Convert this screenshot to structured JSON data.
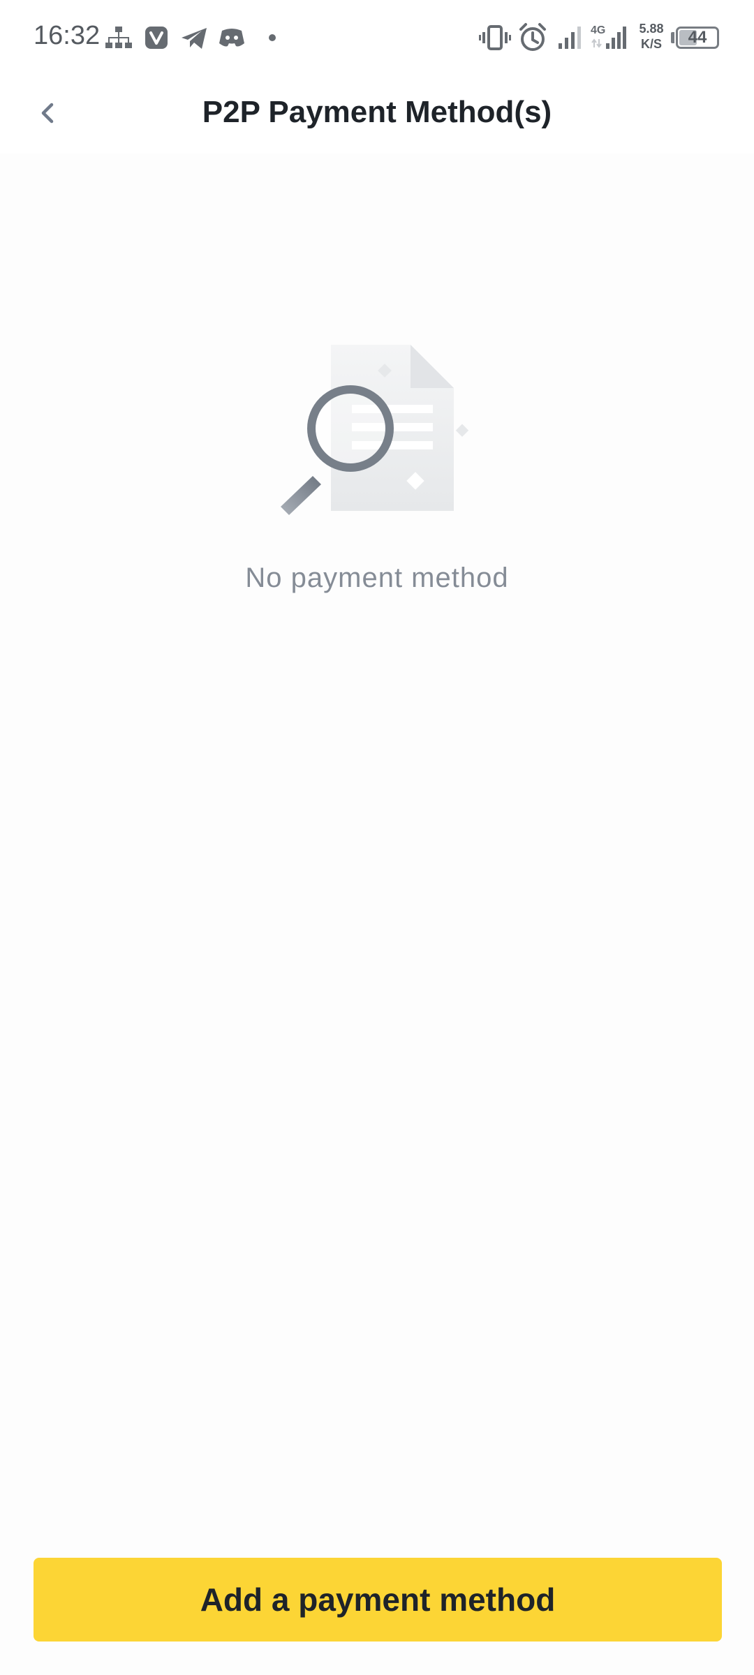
{
  "status_bar": {
    "time": "16:32",
    "network_type": "4G",
    "net_speed_value": "5.88",
    "net_speed_unit": "K/S",
    "battery_level": "44",
    "battery_fraction": 0.44,
    "icons": [
      "network-tree-icon",
      "vivaldi-icon",
      "telegram-icon",
      "discord-icon",
      "notification-dot-icon",
      "vibrate-icon",
      "alarm-icon",
      "signal-icon",
      "signal-4g-icon"
    ]
  },
  "header": {
    "title": "P2P Payment Method(s)",
    "back_icon": "chevron-left-icon"
  },
  "empty_state": {
    "icon": "document-search-icon",
    "message": "No payment method"
  },
  "footer": {
    "add_button_label": "Add a payment method"
  },
  "colors": {
    "accent": "#fcd535",
    "title_text": "#1e2329",
    "muted_text": "#858c96",
    "background": "#fdfdfd"
  }
}
